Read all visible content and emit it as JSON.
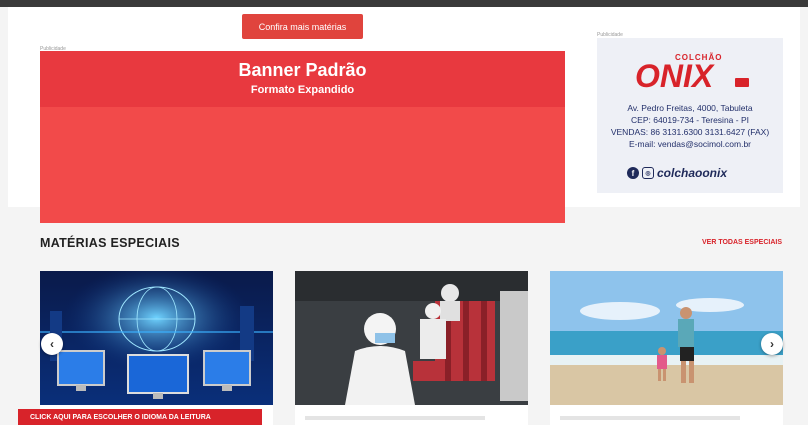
{
  "header": {
    "more_button": "Confira mais matérias"
  },
  "banner": {
    "label": "Publicidade",
    "title": "Banner Padrão",
    "subtitle": "Formato Expandido"
  },
  "ad": {
    "label": "Publicidade",
    "brand_small": "COLCHÃO",
    "brand_main": "ONIX",
    "lines": [
      "Av. Pedro Freitas, 4000, Tabuleta",
      "CEP: 64019-734 - Teresina - PI",
      "VENDAS: 86 3131.6300 3131.6427 (FAX)",
      "E-mail: vendas@socimol.com.br"
    ],
    "social_handle": "colchaoonix",
    "brand_color": "#d8232a"
  },
  "section": {
    "title": "MATÉRIAS ESPECIAIS",
    "see_all": "VER TODAS ESPECIAIS"
  },
  "cards": [
    {
      "image": "computer-monitors-technology-photo"
    },
    {
      "image": "factory-workers-masks-photo"
    },
    {
      "image": "beach-father-child-photo"
    }
  ],
  "carousel": {
    "prev_icon": "chevron-left-icon",
    "next_icon": "chevron-right-icon"
  },
  "language_bar": "CLICK AQUI PARA ESCOLHER O IDIOMA DA LEITURA"
}
